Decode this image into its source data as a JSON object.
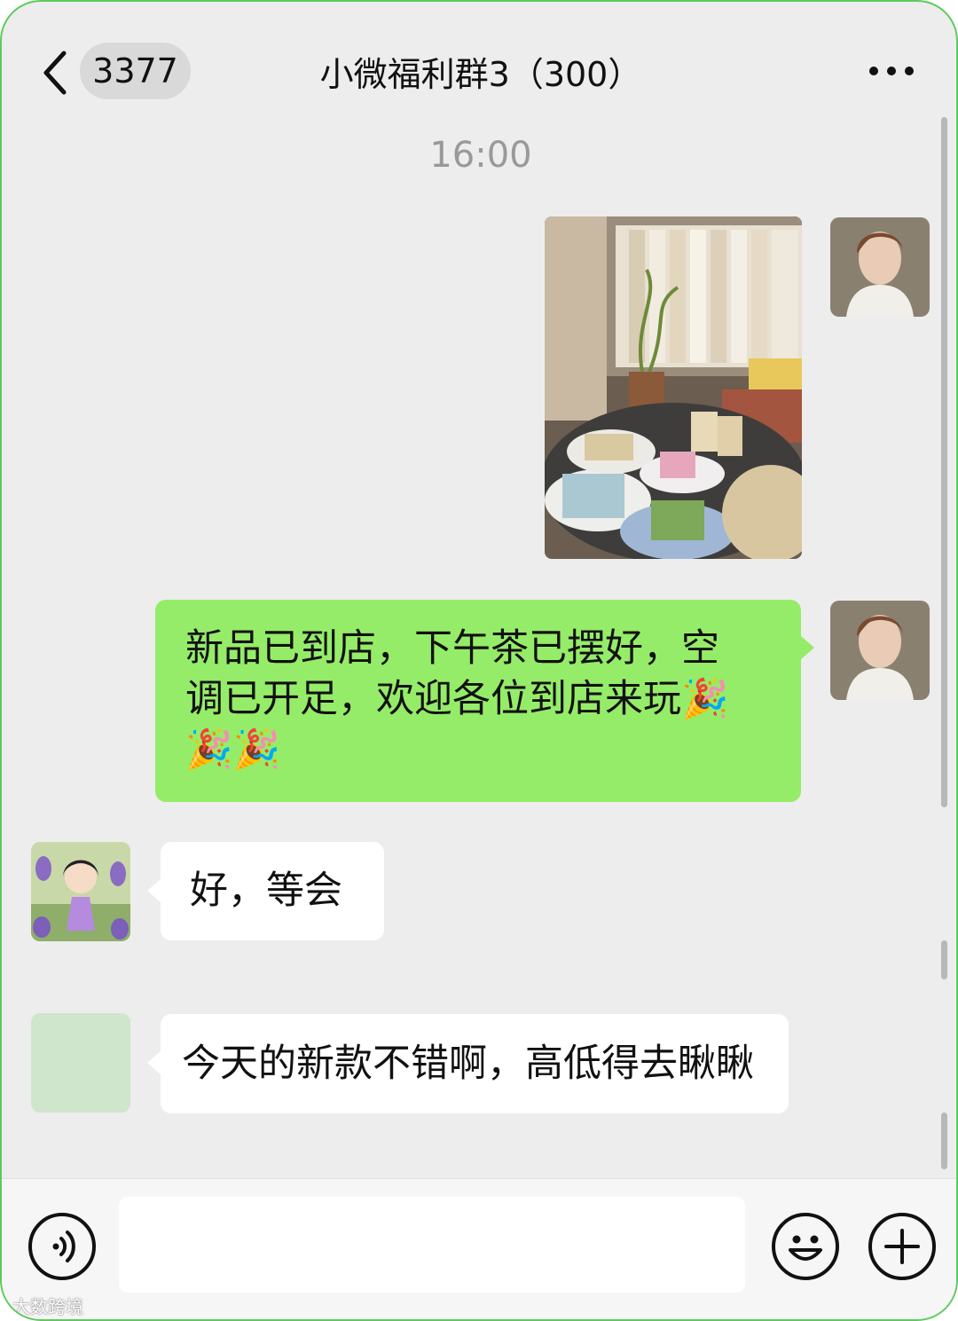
{
  "header": {
    "back_icon": "chevron-left-icon",
    "unread_count": "3377",
    "title": "小微福利群3（300）",
    "more_icon": "more-dots-icon"
  },
  "chat": {
    "timestamp": "16:00",
    "messages": [
      {
        "sender": "self",
        "type": "image"
      },
      {
        "sender": "self",
        "type": "text",
        "text_line1": "新品已到店，下午茶已摆好，空",
        "text_line2": "调已开足，欢迎各位到店来玩🎉",
        "text_line3": "🎉🎉"
      },
      {
        "sender": "other",
        "type": "text",
        "text": "好，等会"
      },
      {
        "sender": "other",
        "type": "text",
        "text": "今天的新款不错啊，高低得去瞅瞅"
      }
    ]
  },
  "input_bar": {
    "voice_icon": "voice-icon",
    "emoji_icon": "emoji-icon",
    "plus_icon": "plus-icon",
    "input_value": ""
  },
  "watermark": "大数跨境",
  "colors": {
    "frame": "#5ccb5c",
    "self_bubble": "#95ec69",
    "other_bubble": "#ffffff",
    "background": "#ededed"
  }
}
